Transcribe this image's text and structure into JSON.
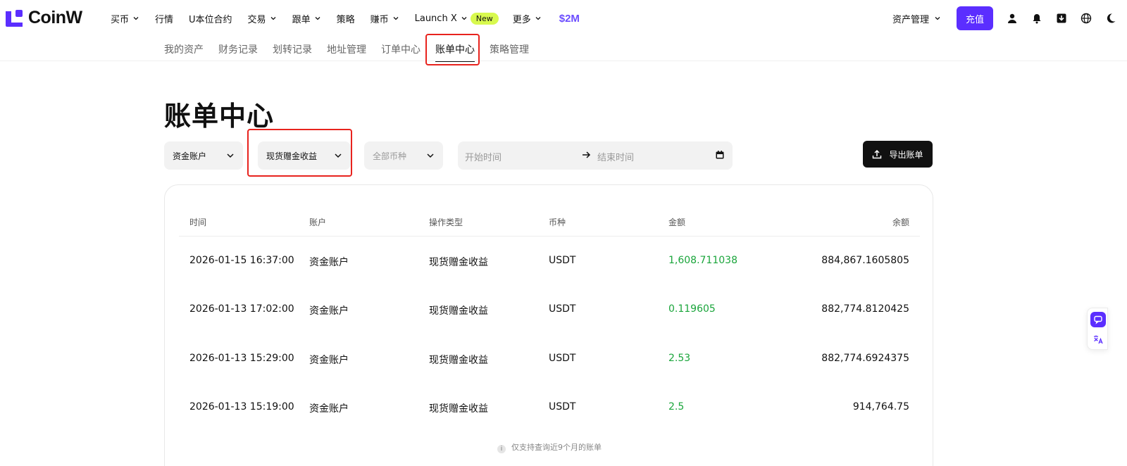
{
  "brand": {
    "name": "CoinW",
    "accent": "#5b2eff",
    "positive": "#1aa53b",
    "highlight": "#e8231e"
  },
  "nav": {
    "items": [
      {
        "label": "买币",
        "dropdown": true
      },
      {
        "label": "行情",
        "dropdown": false
      },
      {
        "label": "U本位合约",
        "dropdown": false
      },
      {
        "label": "交易",
        "dropdown": true
      },
      {
        "label": "跟单",
        "dropdown": true
      },
      {
        "label": "策略",
        "dropdown": false
      },
      {
        "label": "赚币",
        "dropdown": true
      },
      {
        "label": "Launch X",
        "dropdown": true,
        "badge": "New"
      },
      {
        "label": "更多",
        "dropdown": true
      }
    ],
    "promo": "$2M",
    "asset_mgmt": "资产管理",
    "deposit": "充值",
    "icons": [
      "user-icon",
      "bell-icon",
      "download-icon",
      "globe-icon",
      "moon-icon"
    ]
  },
  "subnav": {
    "items": [
      "我的资产",
      "财务记录",
      "划转记录",
      "地址管理",
      "订单中心",
      "账单中心",
      "策略管理"
    ],
    "active": "账单中心"
  },
  "page": {
    "title": "账单中心"
  },
  "filters": {
    "account": "资金账户",
    "type": "现货赠金收益",
    "coin_placeholder": "全部币种",
    "start_placeholder": "开始时间",
    "end_placeholder": "结束时间",
    "export": "导出账单"
  },
  "table": {
    "headers": [
      "时间",
      "账户",
      "操作类型",
      "币种",
      "金额",
      "余额"
    ],
    "rows": [
      {
        "time": "2026-01-15 16:37:00",
        "account": "资金账户",
        "type": "现货赠金收益",
        "coin": "USDT",
        "amount": "1,608.711038",
        "balance": "884,867.1605805"
      },
      {
        "time": "2026-01-13 17:02:00",
        "account": "资金账户",
        "type": "现货赠金收益",
        "coin": "USDT",
        "amount": "0.119605",
        "balance": "882,774.8120425"
      },
      {
        "time": "2026-01-13 15:29:00",
        "account": "资金账户",
        "type": "现货赠金收益",
        "coin": "USDT",
        "amount": "2.53",
        "balance": "882,774.6924375"
      },
      {
        "time": "2026-01-13 15:19:00",
        "account": "资金账户",
        "type": "现货赠金收益",
        "coin": "USDT",
        "amount": "2.5",
        "balance": "914,764.75"
      }
    ],
    "footnote": "仅支持查询近9个月的账单"
  }
}
